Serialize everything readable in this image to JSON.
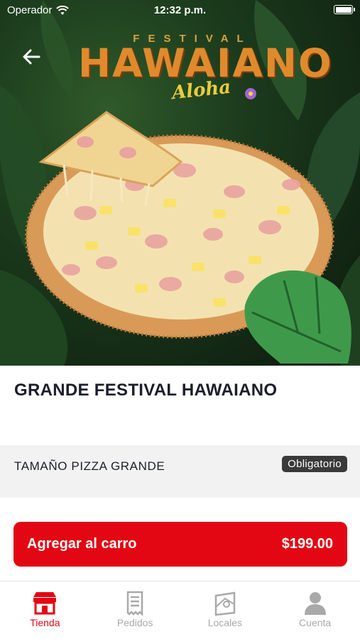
{
  "status_bar": {
    "carrier": "Operador",
    "time": "12:32 p.m."
  },
  "hero": {
    "promo_festival": "FESTIVAL",
    "promo_title": "HAWAIANO",
    "promo_aloha": "Aloha"
  },
  "product": {
    "title": "GRANDE FESTIVAL HAWAIANO"
  },
  "option_group": {
    "title": "TAMAÑO PIZZA GRANDE",
    "badge": "Obligatorio"
  },
  "cart_button": {
    "label": "Agregar al carro",
    "price": "$199.00",
    "color": "#e30613"
  },
  "tabs": [
    {
      "label": "Tienda",
      "icon": "store-icon",
      "active": true
    },
    {
      "label": "Pedidos",
      "icon": "receipt-icon",
      "active": false
    },
    {
      "label": "Locales",
      "icon": "map-icon",
      "active": false
    },
    {
      "label": "Cuenta",
      "icon": "user-icon",
      "active": false
    }
  ]
}
